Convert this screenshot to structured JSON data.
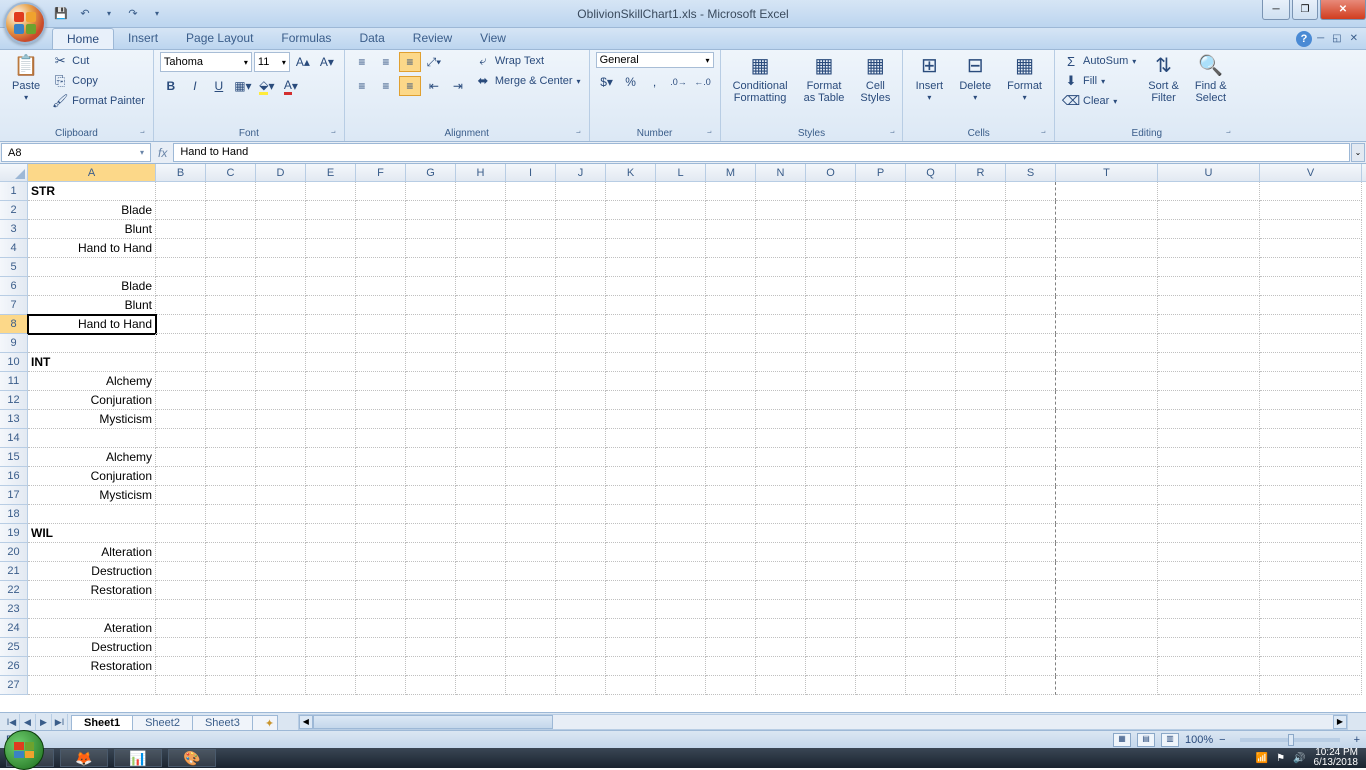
{
  "title": "OblivionSkillChart1.xls - Microsoft Excel",
  "qat": {
    "save": "💾",
    "undo": "↶",
    "redo": "↷",
    "dd": "▾"
  },
  "tabs": [
    "Home",
    "Insert",
    "Page Layout",
    "Formulas",
    "Data",
    "Review",
    "View"
  ],
  "active_tab": "Home",
  "ribbon": {
    "clipboard": {
      "label": "Clipboard",
      "paste": "Paste",
      "cut": "Cut",
      "copy": "Copy",
      "fp": "Format Painter"
    },
    "font": {
      "label": "Font",
      "name": "Tahoma",
      "size": "11",
      "bold": "B",
      "italic": "I",
      "underline": "U"
    },
    "alignment": {
      "label": "Alignment",
      "wrap": "Wrap Text",
      "merge": "Merge & Center"
    },
    "number": {
      "label": "Number",
      "format": "General"
    },
    "styles": {
      "label": "Styles",
      "cf": "Conditional\nFormatting",
      "fat": "Format\nas Table",
      "cs": "Cell\nStyles"
    },
    "cells": {
      "label": "Cells",
      "insert": "Insert",
      "delete": "Delete",
      "format": "Format"
    },
    "editing": {
      "label": "Editing",
      "autosum": "AutoSum",
      "fill": "Fill",
      "clear": "Clear",
      "sort": "Sort &\nFilter",
      "find": "Find &\nSelect"
    }
  },
  "namebox": "A8",
  "formula": "Hand to Hand",
  "columns": [
    "A",
    "B",
    "C",
    "D",
    "E",
    "F",
    "G",
    "H",
    "I",
    "J",
    "K",
    "L",
    "M",
    "N",
    "O",
    "P",
    "Q",
    "R",
    "S",
    "T",
    "U",
    "V"
  ],
  "col_widths": {
    "A": 128,
    "default": 50,
    "T": 102,
    "U": 102,
    "V": 102
  },
  "active_col": "A",
  "active_row": 8,
  "print_last_col": "S",
  "rows": [
    {
      "n": 1,
      "a": "STR",
      "bold": true,
      "align": "left"
    },
    {
      "n": 2,
      "a": "Blade",
      "align": "right"
    },
    {
      "n": 3,
      "a": "Blunt",
      "align": "right"
    },
    {
      "n": 4,
      "a": "Hand to Hand",
      "align": "right"
    },
    {
      "n": 5,
      "a": ""
    },
    {
      "n": 6,
      "a": "Blade",
      "align": "right"
    },
    {
      "n": 7,
      "a": "Blunt",
      "align": "right"
    },
    {
      "n": 8,
      "a": "Hand to Hand",
      "align": "right",
      "selected": true
    },
    {
      "n": 9,
      "a": ""
    },
    {
      "n": 10,
      "a": "INT",
      "bold": true,
      "align": "left"
    },
    {
      "n": 11,
      "a": "Alchemy",
      "align": "right"
    },
    {
      "n": 12,
      "a": "Conjuration",
      "align": "right"
    },
    {
      "n": 13,
      "a": "Mysticism",
      "align": "right"
    },
    {
      "n": 14,
      "a": ""
    },
    {
      "n": 15,
      "a": "Alchemy",
      "align": "right"
    },
    {
      "n": 16,
      "a": "Conjuration",
      "align": "right"
    },
    {
      "n": 17,
      "a": "Mysticism",
      "align": "right"
    },
    {
      "n": 18,
      "a": ""
    },
    {
      "n": 19,
      "a": "WIL",
      "bold": true,
      "align": "left"
    },
    {
      "n": 20,
      "a": "Alteration",
      "align": "right"
    },
    {
      "n": 21,
      "a": "Destruction",
      "align": "right"
    },
    {
      "n": 22,
      "a": "Restoration",
      "align": "right"
    },
    {
      "n": 23,
      "a": ""
    },
    {
      "n": 24,
      "a": "Ateration",
      "align": "right"
    },
    {
      "n": 25,
      "a": "Destruction",
      "align": "right"
    },
    {
      "n": 26,
      "a": "Restoration",
      "align": "right"
    },
    {
      "n": 27,
      "a": ""
    }
  ],
  "sheets": [
    "Sheet1",
    "Sheet2",
    "Sheet3"
  ],
  "active_sheet": "Sheet1",
  "status": "Ready",
  "zoom": "100%",
  "tray": {
    "time": "10:24 PM",
    "date": "6/13/2018"
  }
}
